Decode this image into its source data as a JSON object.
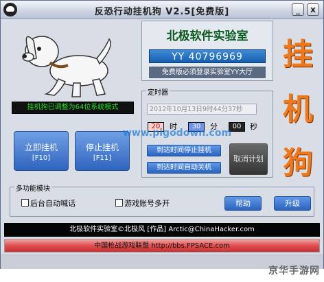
{
  "window": {
    "title": "反恐行动挂机狗 V2.5[免费版]",
    "minimize_label": "_",
    "close_label": "x"
  },
  "status_strip": "挂机狗已调整为64位系统模式",
  "buttons": {
    "start": {
      "label": "立即挂机",
      "hotkey": "[F10]"
    },
    "stop": {
      "label": "停止挂机",
      "hotkey": "[F11]"
    }
  },
  "lab": {
    "title": "北极软件实验室",
    "yy": "YY 40796969",
    "notice": "免费版必须登录实验室YY大厅"
  },
  "big_chars": [
    "挂",
    "机",
    "狗"
  ],
  "timer": {
    "group_label": "定时器",
    "datetime": "2012年10月13日9时44分37秒",
    "hour": "20",
    "hour_unit": "时",
    "minute": "30",
    "minute_unit": "分",
    "second": "00",
    "second_unit": "秒",
    "stop_at_time": "到达时间停止挂机",
    "shutdown_at_time": "到达时间自动关机",
    "cancel_plan": "取消计划"
  },
  "watermark": "www.pigodown.com",
  "multi": {
    "group_label": "多功能模块",
    "auto_shout": "后台自动喊话",
    "multi_account": "游戏账号多开",
    "help": "帮助",
    "upgrade": "升级"
  },
  "footer": {
    "credits": "北极软件实验室©北极风 [作品]     Arctic@ChinaHacker.com",
    "forum": "中国枪战游戏联盟 http://bbs.FPSACE.com"
  },
  "site_mark": "京华手游网",
  "colors": {
    "status_green": "#22e024",
    "accent_orange": "#f07818",
    "lab_green": "#0a5a20",
    "button_blue": "#2a64c0"
  }
}
